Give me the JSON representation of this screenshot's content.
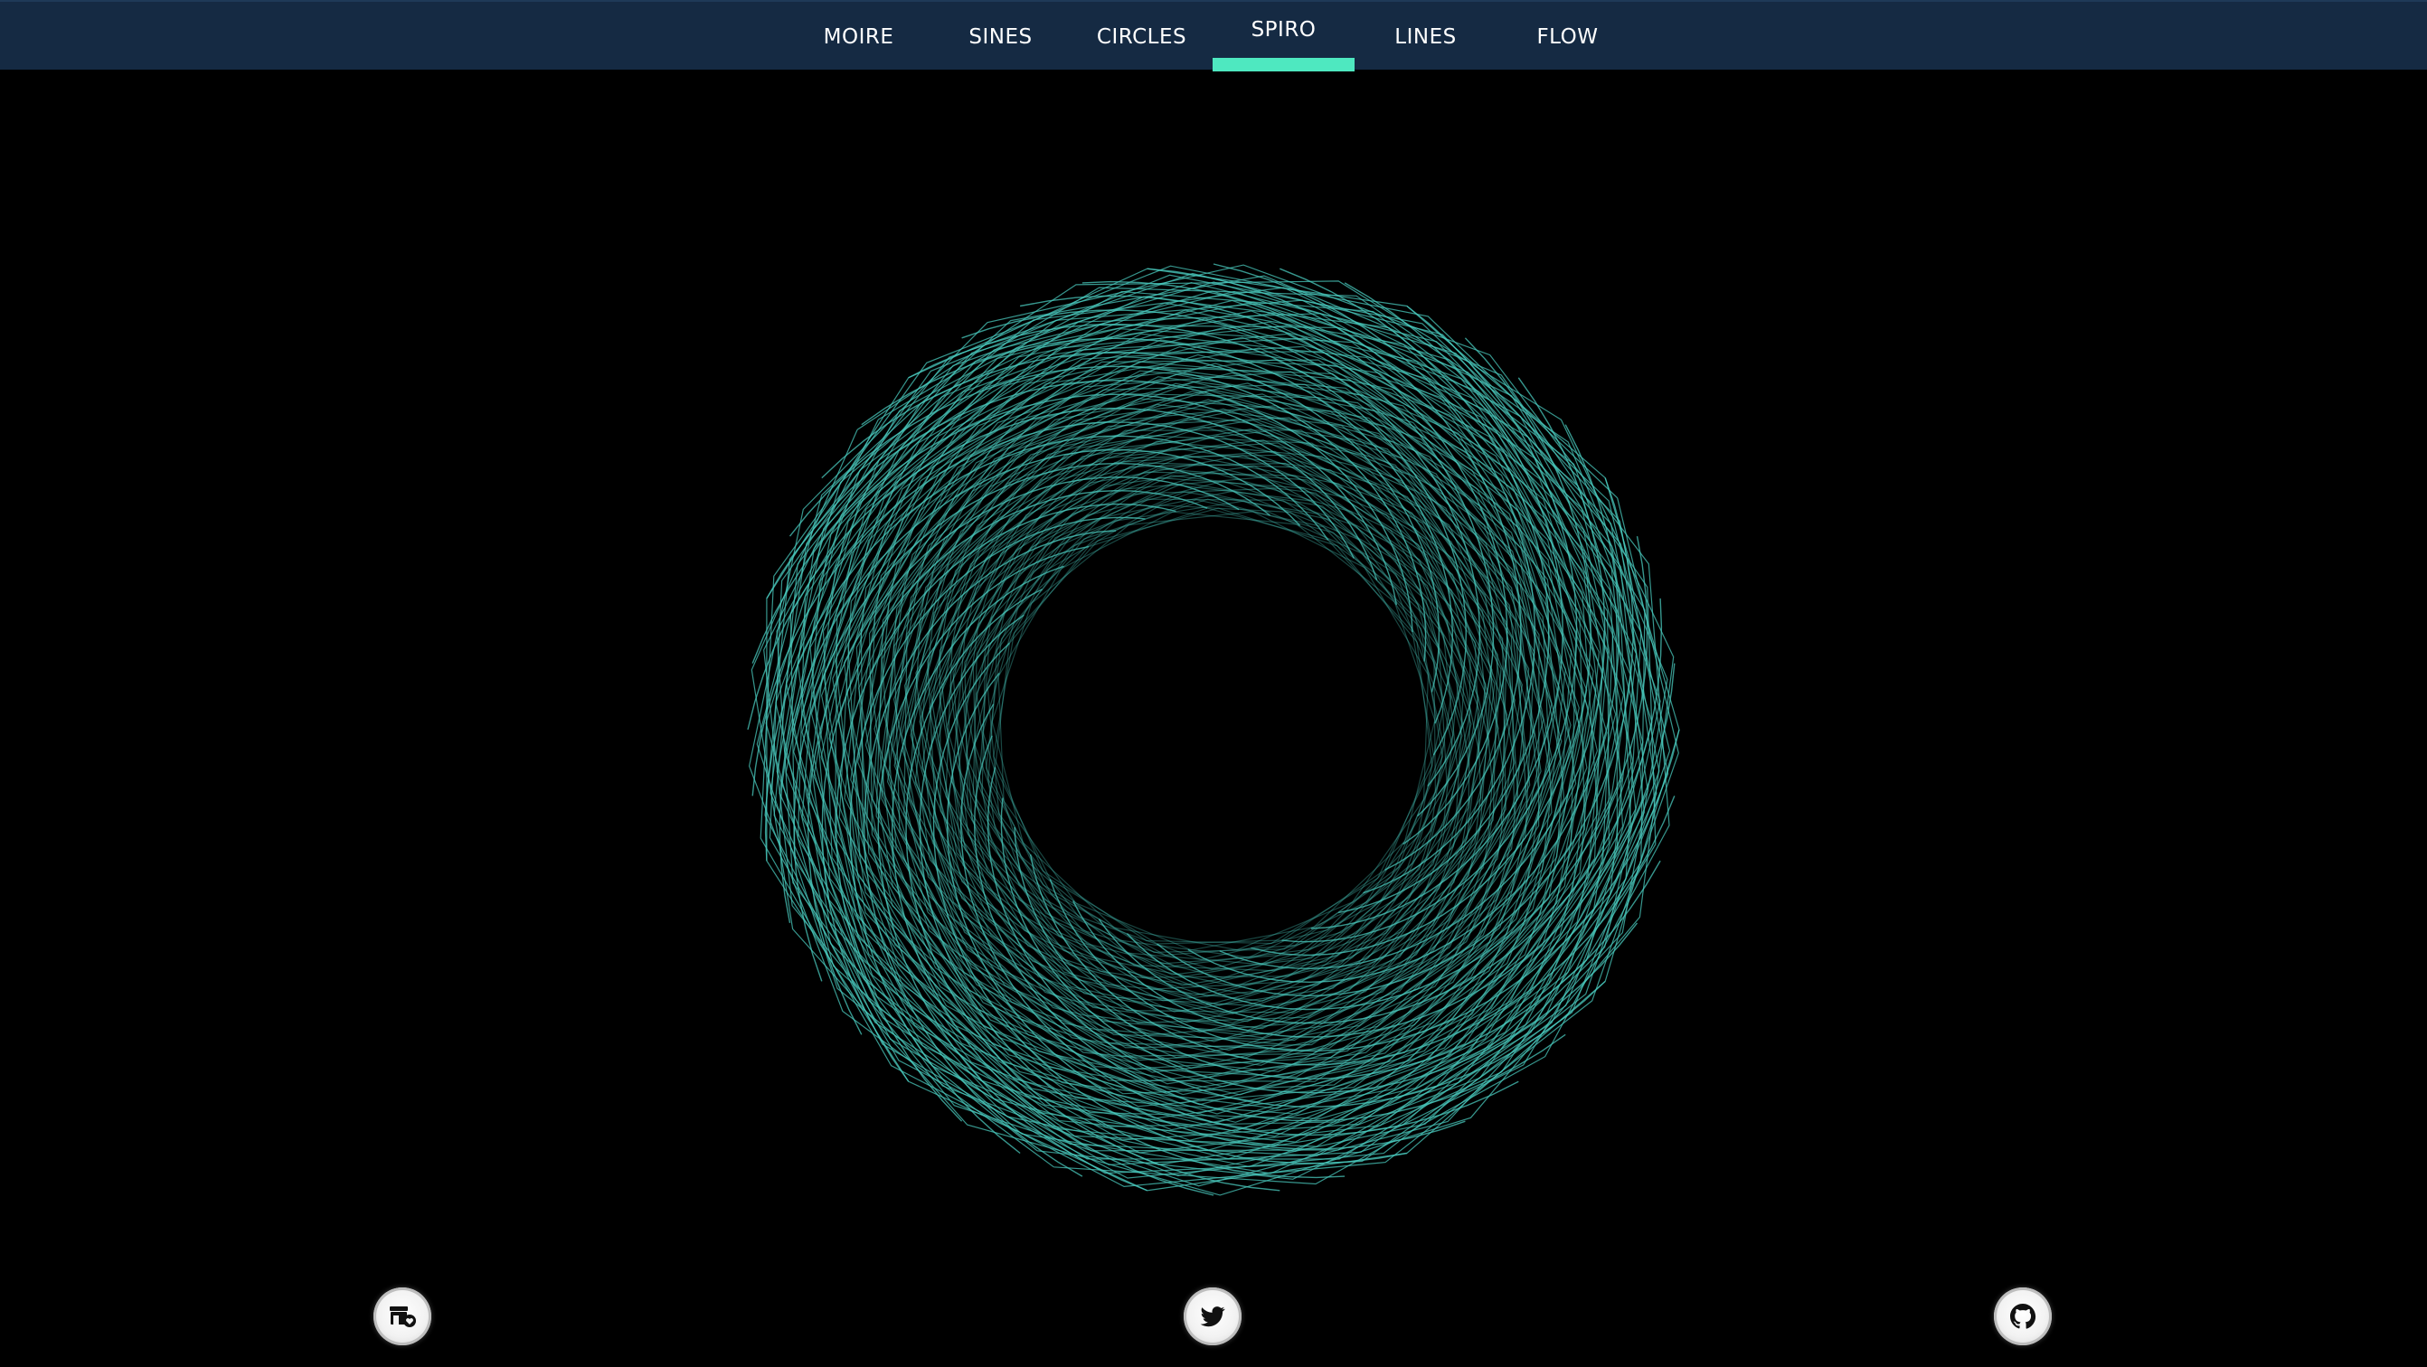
{
  "nav": {
    "items": [
      {
        "label": "MOIRE"
      },
      {
        "label": "SINES"
      },
      {
        "label": "CIRCLES"
      },
      {
        "label": "SPIRO"
      },
      {
        "label": "LINES"
      },
      {
        "label": "FLOW"
      }
    ],
    "active": "SPIRO"
  },
  "colors": {
    "nav_background": "#152a43",
    "accent": "#4ee8c0",
    "stroke": "#49c9bd",
    "background": "#000000"
  },
  "artwork": {
    "style": "spirograph",
    "polygon_sides": 11,
    "ring_count": 4
  },
  "social": {
    "links": [
      {
        "icon": "store-heart-icon"
      },
      {
        "icon": "twitter-icon"
      },
      {
        "icon": "github-icon"
      }
    ]
  }
}
